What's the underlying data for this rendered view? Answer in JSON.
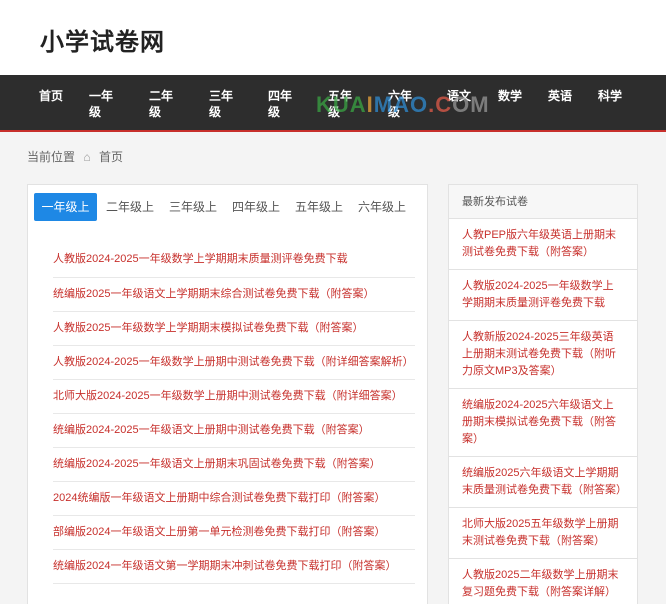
{
  "site": {
    "title": "小学试卷网"
  },
  "nav": {
    "items": [
      "首页",
      "一年级",
      "二年级",
      "三年级",
      "四年级",
      "五年级",
      "六年级",
      "语文",
      "数学",
      "英语",
      "科学"
    ]
  },
  "watermark": {
    "text": "KUAIMAO.COM"
  },
  "breadcrumb": {
    "label": "当前位置",
    "icon": "home-icon",
    "current": "首页"
  },
  "tabs": [
    "一年级上",
    "二年级上",
    "三年级上",
    "四年级上",
    "五年级上",
    "六年级上"
  ],
  "list": [
    "人教版2024-2025一年级数学上学期期末质量测评卷免费下载",
    "统编版2025一年级语文上学期期末综合测试卷免费下载（附答案）",
    "人教版2025一年级数学上学期期末模拟试卷免费下载（附答案）",
    "人教版2024-2025一年级数学上册期中测试卷免费下载（附详细答案解析）",
    "北师大版2024-2025一年级数学上册期中测试卷免费下载（附详细答案）",
    "统编版2024-2025一年级语文上册期中测试卷免费下载（附答案）",
    "统编版2024-2025一年级语文上册期末巩固试卷免费下载（附答案）",
    "2024统编版一年级语文上册期中综合测试卷免费下载打印（附答案）",
    "部编版2024一年级语文上册第一单元检测卷免费下载打印（附答案）",
    "统编版2024一年级语文第一学期期末冲刺试卷免费下载打印（附答案）"
  ],
  "side": {
    "title": "最新发布试卷",
    "items": [
      "人教PEP版六年级英语上册期末测试卷免费下载（附答案）",
      "人教版2024-2025一年级数学上学期期末质量测评卷免费下载",
      "人教新版2024-2025三年级英语上册期末测试卷免费下载（附听力原文MP3及答案）",
      "统编版2024-2025六年级语文上册期末模拟试卷免费下载（附答案）",
      "统编版2025六年级语文上学期期末质量测试卷免费下载（附答案）",
      "北师大版2025五年级数学上册期末测试卷免费下载（附答案）",
      "人教版2025二年级数学上册期末复习题免费下载（附答案详解）"
    ]
  },
  "colors": {
    "accent": "#1e88e5",
    "link": "#c7302c",
    "nav_bg": "#2d2d2d"
  }
}
